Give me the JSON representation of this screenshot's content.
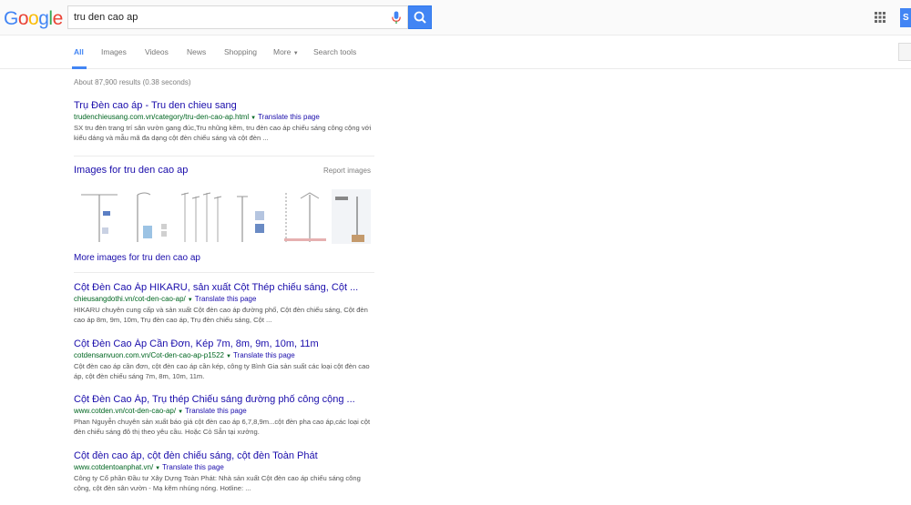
{
  "header": {
    "logo": "Google",
    "search_value": "tru den cao ap",
    "signin_label": "S"
  },
  "tabs": [
    {
      "label": "All"
    },
    {
      "label": "Images"
    },
    {
      "label": "Videos"
    },
    {
      "label": "News"
    },
    {
      "label": "Shopping"
    },
    {
      "label": "More"
    },
    {
      "label": "Search tools"
    }
  ],
  "stats": "About 87,900 results (0.38 seconds)",
  "results": [
    {
      "title": "Trụ Đèn cao áp - Tru den chieu sang",
      "url": "trudenchieusang.com.vn/category/tru-den-cao-ap.html",
      "translate": "Translate this page",
      "snippet": "SX tru đèn trang trí sân vườn gang đúc,Tru nhũng kẽm, tru đèn cao áp chiếu sáng công cộng với kiểu dáng và mẫu mã đa dạng cột đèn chiếu sáng và cột đèn ..."
    },
    {
      "title": "Cột Đèn Cao Áp HIKARU, sản xuất Cột Thép chiếu sáng, Cột ...",
      "url": "chieusangdothi.vn/cot-den-cao-ap/",
      "translate": "Translate this page",
      "snippet": "HIKARU chuyên cung cấp và sản xuất Cột đèn cao áp đường phố, Cột đèn chiếu sáng, Cột đèn cao áp 8m, 9m, 10m, Trụ đèn cao áp, Trụ đèn chiếu sáng, Cột ..."
    },
    {
      "title": "Cột Đèn Cao Áp Cần Đơn, Kép 7m, 8m, 9m, 10m, 11m",
      "url": "cotdensanvuon.com.vn/Cot-den-cao-ap-p1522",
      "translate": "Translate this page",
      "snippet": "Cột đèn cao áp cần đơn, cột đèn cao áp cần kép, công ty Bình Gia sản suất các loại cột đèn cao áp, cột đèn chiếu sáng 7m, 8m, 10m, 11m."
    },
    {
      "title": "Cột Đèn Cao Áp, Trụ thép Chiếu sáng đường phố công cộng ...",
      "url": "www.cotden.vn/cot-den-cao-ap/",
      "translate": "Translate this page",
      "snippet": "Phan Nguyễn chuyên sản xuất báo giá cột đèn cao áp 6,7,8,9m...cột đèn pha cao áp,các loại cột đèn chiếu sáng đô thị theo yêu cầu. Hoặc Cỏ Sẵn tại xưởng."
    },
    {
      "title": "Cột đèn cao áp, cột đèn chiếu sáng, cột đèn Toàn Phát",
      "url": "www.cotdentoanphat.vn/",
      "translate": "Translate this page",
      "snippet": "Công ty Cổ phần Đầu tư Xây Dựng Toàn Phát: Nhà sản xuất Cột đèn cao áp chiếu sáng công cộng, cột đèn sân vườn - Mạ kẽm nhúng nóng. Hotline: ..."
    }
  ],
  "images_block": {
    "title": "Images for tru den cao ap",
    "report": "Report images",
    "more": "More images for tru den cao ap"
  },
  "colors": {
    "link": "#1a0dab",
    "url": "#006621",
    "accent": "#4285f4"
  }
}
